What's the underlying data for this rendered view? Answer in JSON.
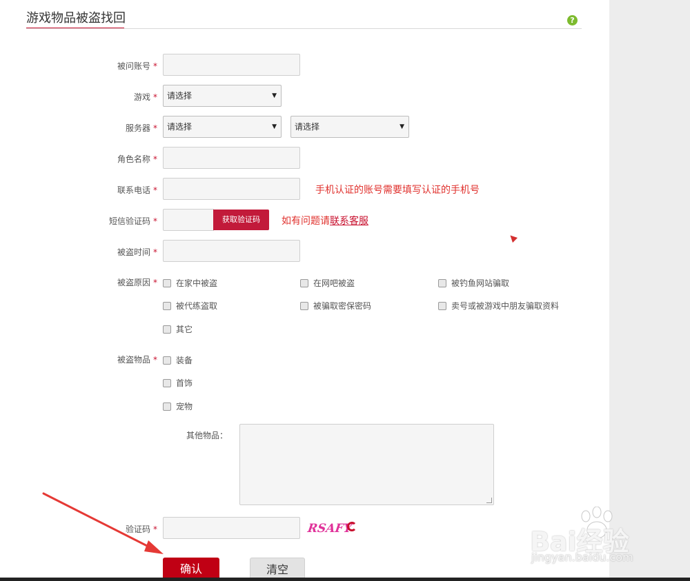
{
  "header": {
    "title": "游戏物品被盗找回",
    "help_icon": "help-icon",
    "help_glyph": "?"
  },
  "form": {
    "account_label": "被问账号",
    "game_label": "游戏",
    "game_select": "请选择",
    "server_label": "服务器",
    "server_select_1": "请选择",
    "server_select_2": "请选择",
    "role_label": "角色名称",
    "phone_label": "联系电话",
    "phone_hint": "手机认证的账号需要填写认证的手机号",
    "sms_label": "短信验证码",
    "sms_button": "获取验证码",
    "sms_hint_prefix": "如有问题请",
    "sms_hint_link": "联系客服",
    "time_label": "被盗时间",
    "reason_label": "被盗原因",
    "reasons": [
      "在家中被盗",
      "在网吧被盗",
      "被钓鱼网站骗取",
      "被代练盗取",
      "被骗取密保密码",
      "卖号或被游戏中朋友骗取资料",
      "其它"
    ],
    "items_label": "被盗物品",
    "items": [
      "装备",
      "首饰",
      "宠物"
    ],
    "other_items_label": "其他物品：",
    "captcha_label": "验证码",
    "captcha_text": "RSAFY",
    "required_mark": "*"
  },
  "buttons": {
    "confirm": "确认",
    "clear": "清空"
  },
  "watermark": {
    "text": "Bai经验",
    "sub": "jingyan.baidu.com",
    "text_bai": "Bai",
    "text_du": "du",
    "text_jy": "经验"
  },
  "colors": {
    "accent": "#c8102e",
    "button_red": "#c00014",
    "hint_red": "#e0322e",
    "captcha_pink": "#e0339a"
  }
}
